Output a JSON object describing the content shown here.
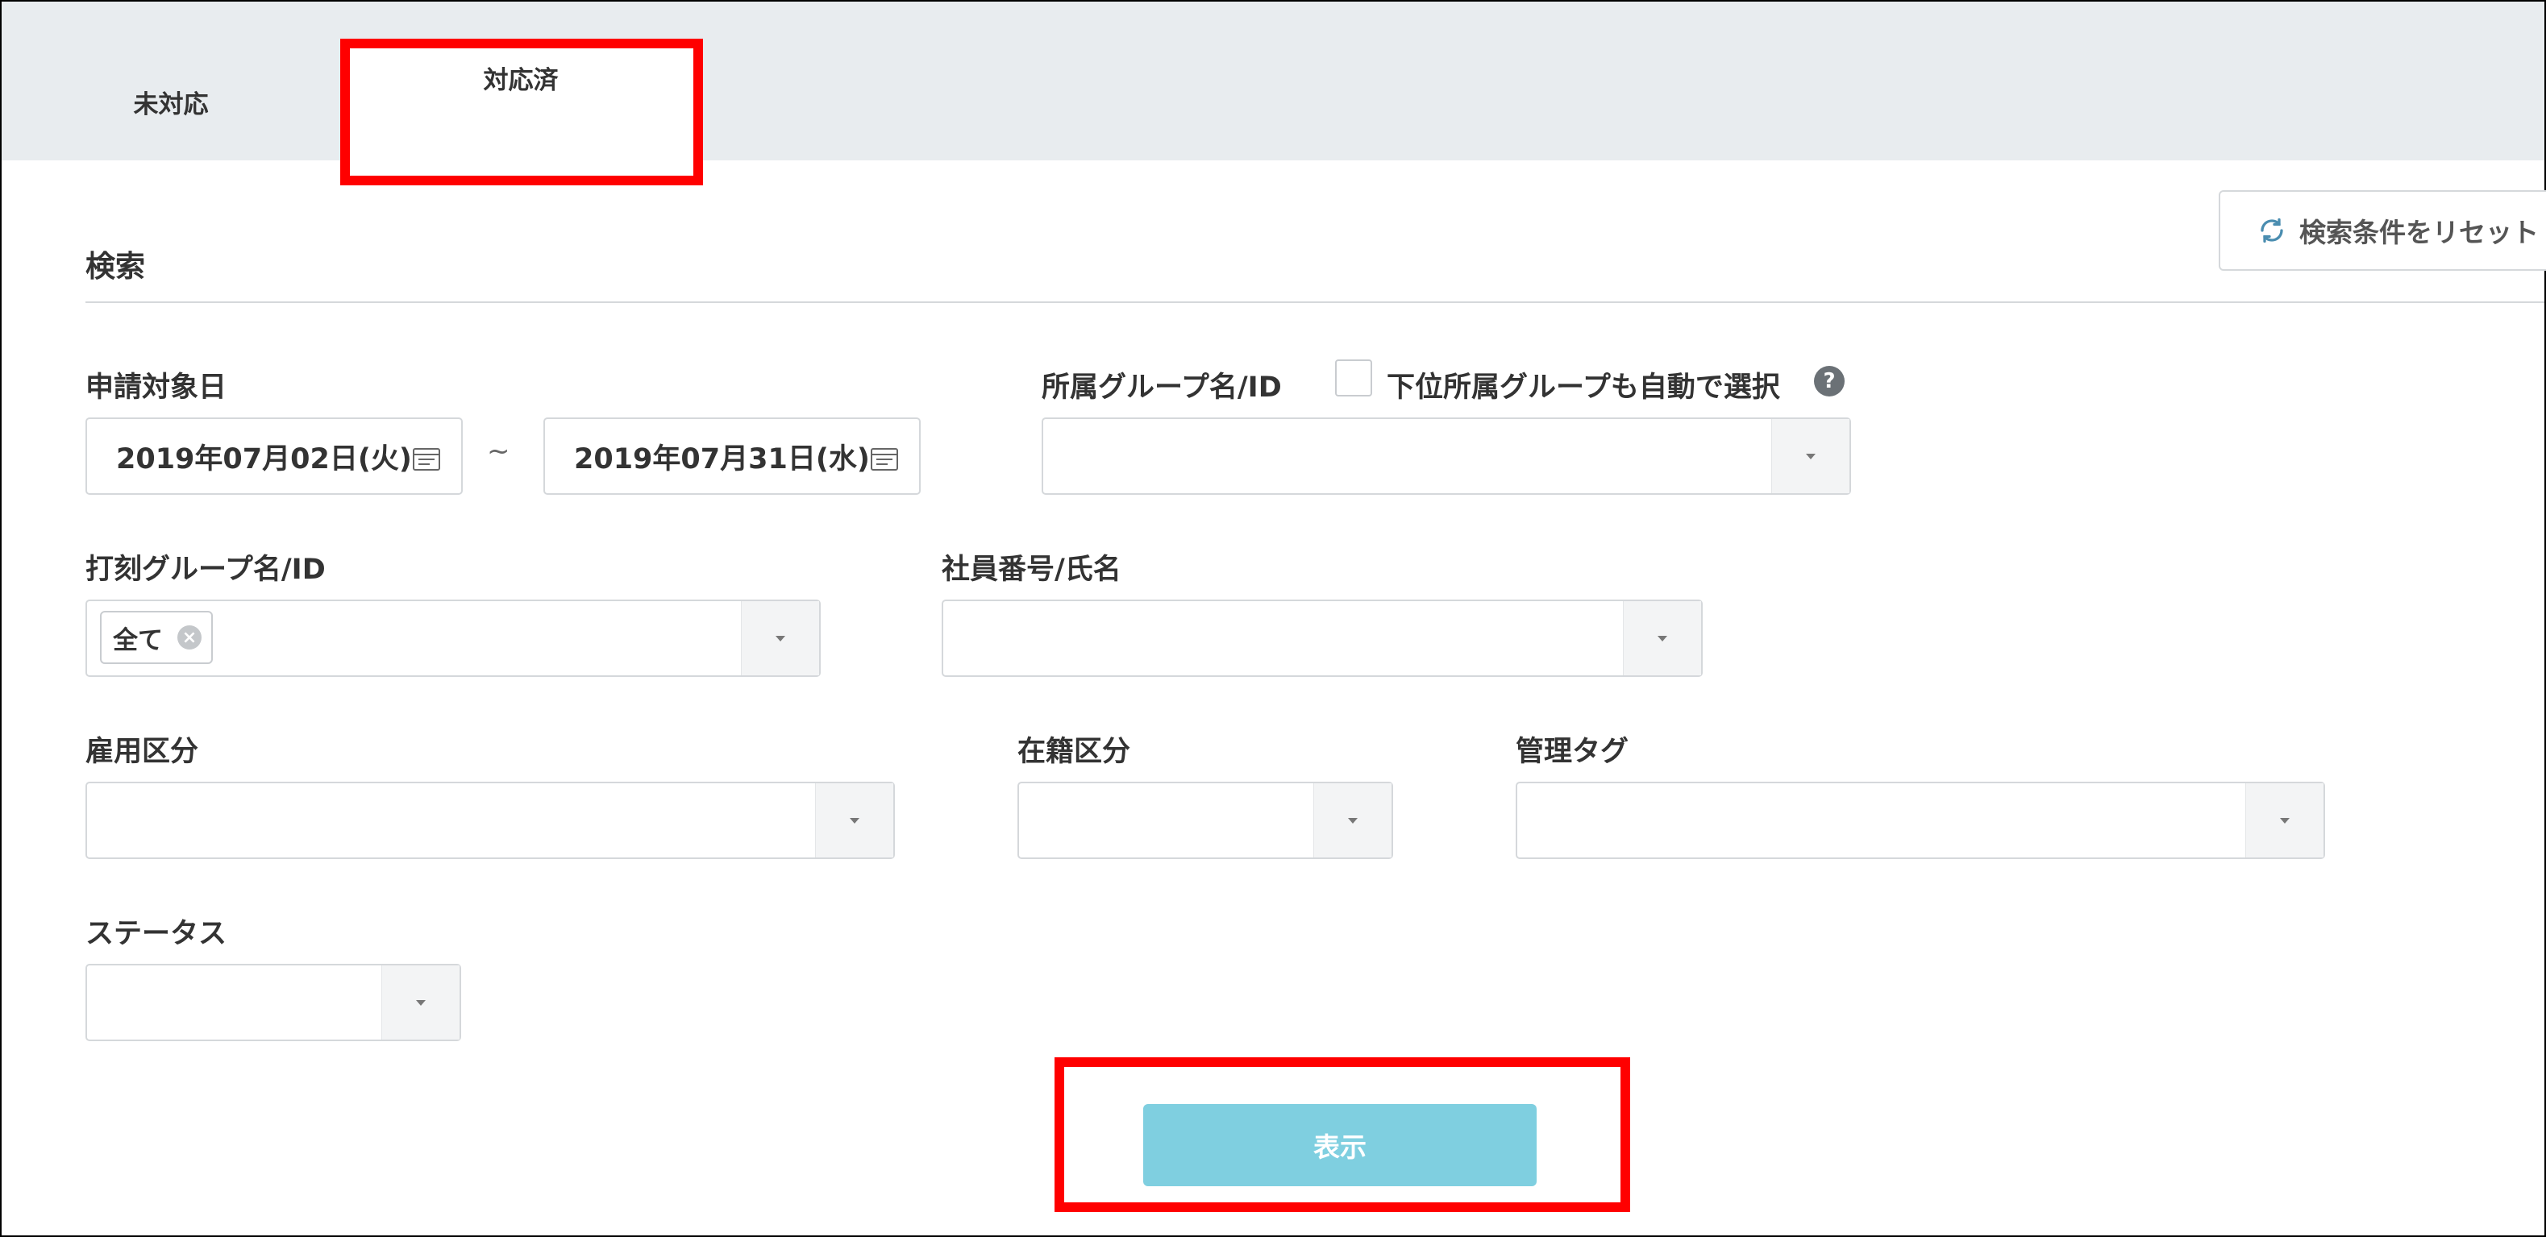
{
  "tabs": [
    {
      "label": "未対応"
    },
    {
      "label": "対応済"
    }
  ],
  "search": {
    "title": "検索",
    "reset_label": "検索条件をリセット"
  },
  "fields": {
    "application_date": {
      "label": "申請対象日",
      "from": "2019年07月02日(火)",
      "separator": "~",
      "to": "2019年07月31日(水)"
    },
    "group": {
      "label": "所属グループ名/ID",
      "checkbox_label": "下位所属グループも自動で選択",
      "help": "?"
    },
    "clock_group": {
      "label": "打刻グループ名/ID",
      "chip": "全て",
      "chip_remove": "×"
    },
    "employee": {
      "label": "社員番号/氏名"
    },
    "employment_type": {
      "label": "雇用区分"
    },
    "enrollment": {
      "label": "在籍区分"
    },
    "management_tag": {
      "label": "管理タグ"
    },
    "status": {
      "label": "ステータス"
    }
  },
  "submit_label": "表示",
  "colors": {
    "tab_bar_bg": "#e8ecef",
    "highlight": "#ff0000",
    "submit_bg": "#7fcfe0"
  }
}
